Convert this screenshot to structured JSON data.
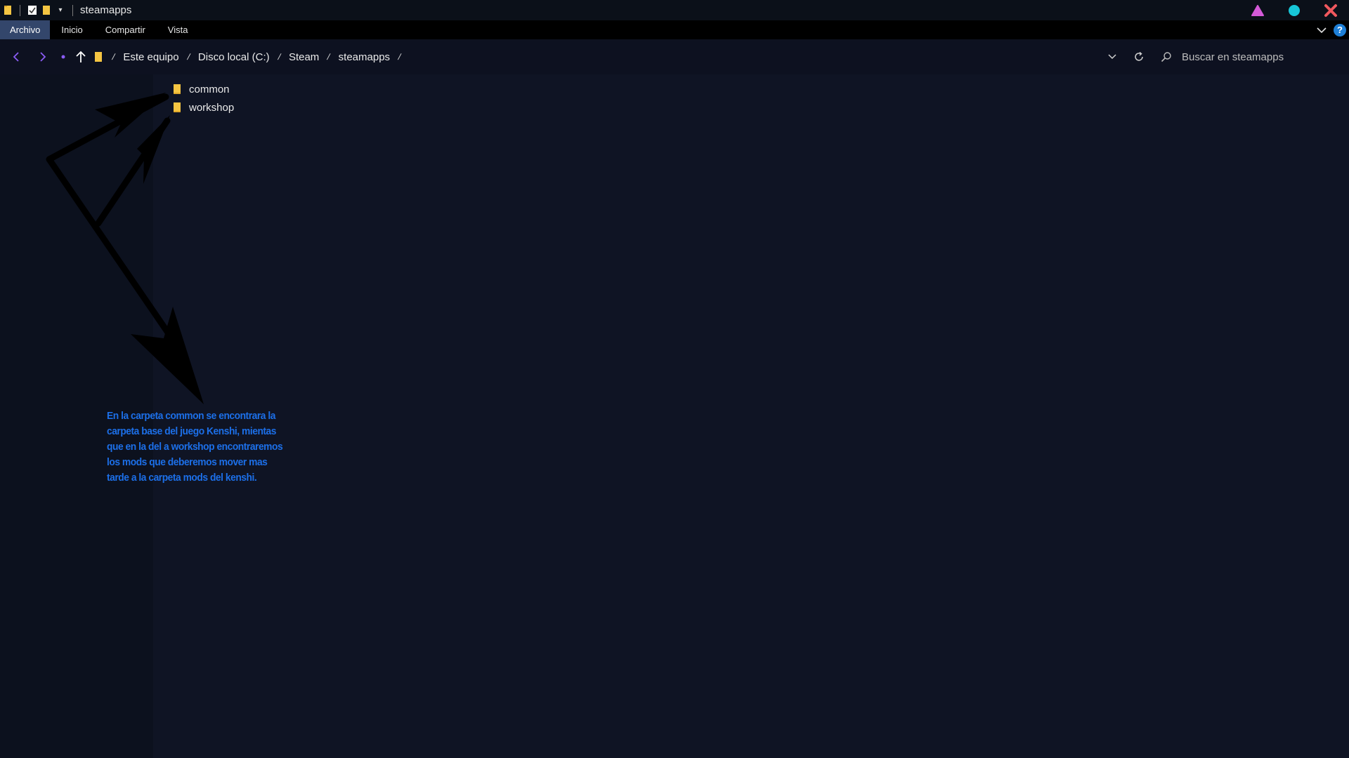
{
  "window": {
    "title": "steamapps",
    "colors": {
      "folder": "#f5c542",
      "minimize": "#d45ad8",
      "maximize": "#17c6d8",
      "close": "#f0585e"
    }
  },
  "ribbon": {
    "tabs": [
      {
        "label": "Archivo",
        "active": true
      },
      {
        "label": "Inicio"
      },
      {
        "label": "Compartir"
      },
      {
        "label": "Vista"
      }
    ]
  },
  "breadcrumb": {
    "items": [
      "Este equipo",
      "Disco local (C:)",
      "Steam",
      "steamapps"
    ]
  },
  "search": {
    "placeholder": "Buscar en steamapps"
  },
  "files": [
    {
      "name": "common",
      "icon": "folder-icon"
    },
    {
      "name": "workshop",
      "icon": "folder-icon"
    }
  ],
  "annotation": {
    "lines": [
      "En la carpeta common se encontrara la",
      "carpeta base del juego Kenshi, mientas",
      "que en la del a workshop encontraremos",
      "los mods que deberemos mover mas",
      "tarde a la carpeta mods del kenshi."
    ],
    "color": "#1c6fe8"
  }
}
